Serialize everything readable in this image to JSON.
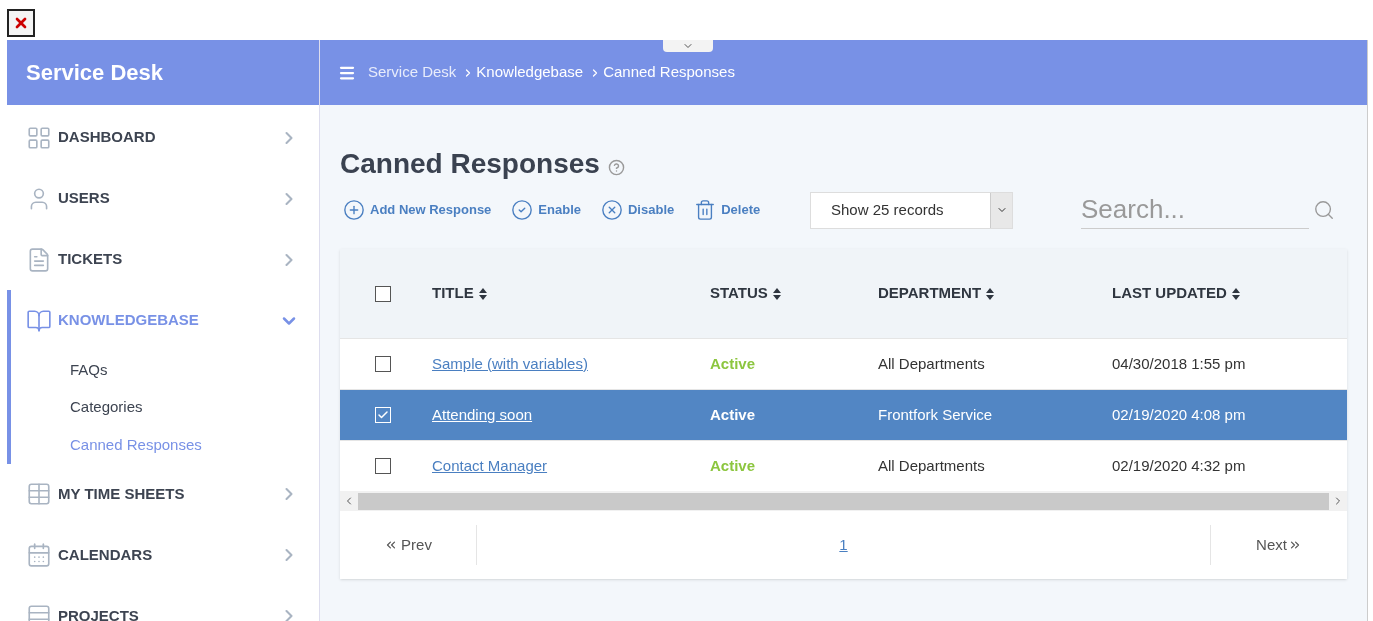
{
  "sidebar": {
    "title": "Service Desk",
    "items": [
      {
        "label": "DASHBOARD",
        "selected": false,
        "expanded": false
      },
      {
        "label": "USERS",
        "selected": false,
        "expanded": false
      },
      {
        "label": "TICKETS",
        "selected": false,
        "expanded": false
      },
      {
        "label": "KNOWLEDGEBASE",
        "selected": true,
        "expanded": true,
        "children": [
          {
            "label": "FAQs",
            "selected": false
          },
          {
            "label": "Categories",
            "selected": false
          },
          {
            "label": "Canned Responses",
            "selected": true
          }
        ]
      },
      {
        "label": "MY TIME SHEETS",
        "selected": false,
        "expanded": false
      },
      {
        "label": "CALENDARS",
        "selected": false,
        "expanded": false
      },
      {
        "label": "PROJECTS",
        "selected": false,
        "expanded": false
      }
    ]
  },
  "breadcrumb": [
    "Service Desk",
    "Knowledgebase",
    "Canned Responses"
  ],
  "page": {
    "title": "Canned Responses"
  },
  "toolbar": [
    {
      "label": "Add New Response"
    },
    {
      "label": "Enable"
    },
    {
      "label": "Disable"
    },
    {
      "label": "Delete"
    }
  ],
  "records_select": {
    "value": "Show 25 records"
  },
  "search": {
    "placeholder": "Search..."
  },
  "table": {
    "all_checked": false,
    "columns": [
      "TITLE",
      "STATUS",
      "DEPARTMENT",
      "LAST UPDATED"
    ],
    "rows": [
      {
        "title": "Sample (with variables)",
        "status": "Active",
        "department": "All Departments",
        "updated": "04/30/2018 1:55 pm",
        "selected": false,
        "checked": false
      },
      {
        "title": "Attending soon",
        "status": "Active",
        "department": "Frontfork Service",
        "updated": "02/19/2020 4:08 pm",
        "selected": true,
        "checked": true
      },
      {
        "title": "Contact Manager",
        "status": "Active",
        "department": "All Departments",
        "updated": "02/19/2020 4:32 pm",
        "selected": false,
        "checked": false
      }
    ]
  },
  "pagination": {
    "prev": "Prev",
    "pages": [
      {
        "label": "1",
        "selected": true
      }
    ],
    "next": "Next"
  }
}
